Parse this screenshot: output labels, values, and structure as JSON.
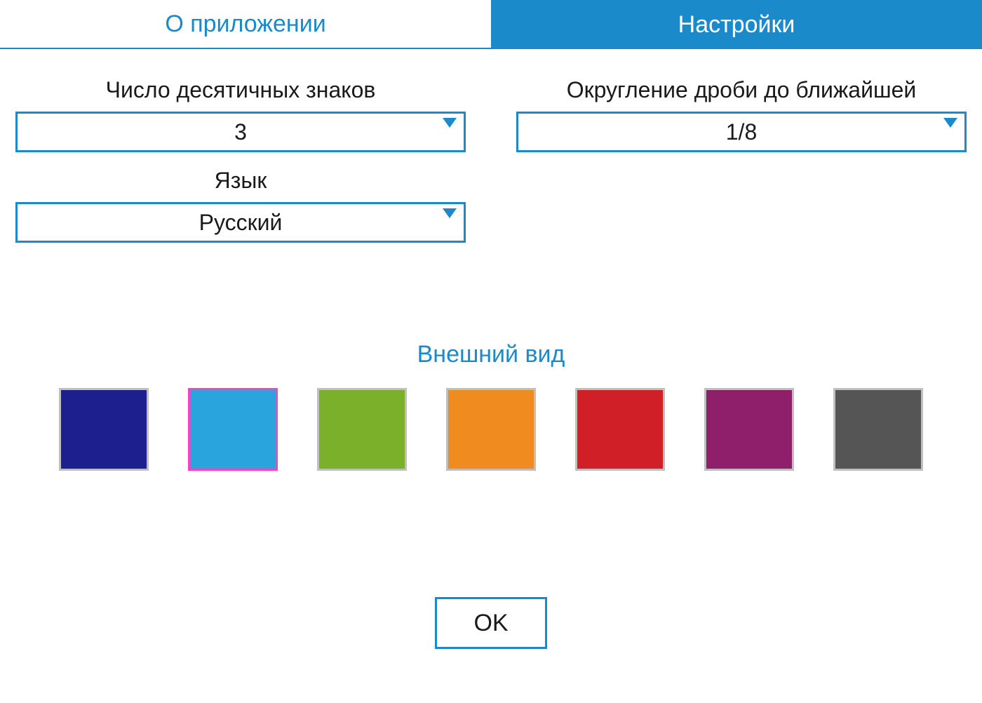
{
  "tabs": {
    "about": "О приложении",
    "settings": "Настройки",
    "active": "settings"
  },
  "fields": {
    "decimal_places": {
      "label": "Число десятичных знаков",
      "value": "3"
    },
    "fraction_round": {
      "label": "Округление дроби до ближайшей",
      "value": "1/8"
    },
    "language": {
      "label": "Язык",
      "value": "Русский"
    }
  },
  "appearance": {
    "label": "Внешний вид",
    "selected_index": 1,
    "colors": [
      "#1d1f8f",
      "#2aa4dd",
      "#7bb02a",
      "#f08b1f",
      "#d01f26",
      "#8f1f6a",
      "#555555"
    ]
  },
  "buttons": {
    "ok": "OK"
  },
  "accent": "#1a8acb"
}
